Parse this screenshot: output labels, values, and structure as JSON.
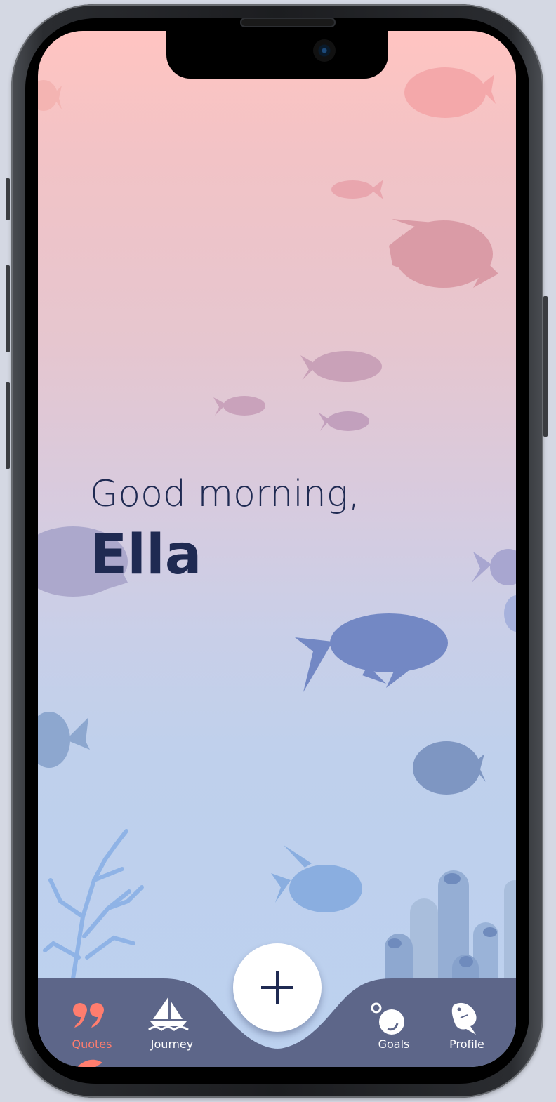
{
  "greeting": {
    "line1": "Good morning,",
    "name": "Ella"
  },
  "fab": {
    "icon": "plus-icon"
  },
  "nav": {
    "items": [
      {
        "label": "Quotes",
        "icon": "quote-icon",
        "active": true
      },
      {
        "label": "Journey",
        "icon": "sailboat-icon",
        "active": false
      },
      {
        "label": "Goals",
        "icon": "bubbles-icon",
        "active": false
      },
      {
        "label": "Profile",
        "icon": "fish-icon",
        "active": false
      }
    ]
  },
  "colors": {
    "text_dark": "#1f2a52",
    "nav_bg": "#5d6689",
    "active": "#ff7d6e",
    "sky_top": "#ffc4c1",
    "sea_bottom": "#bcd1ef"
  }
}
